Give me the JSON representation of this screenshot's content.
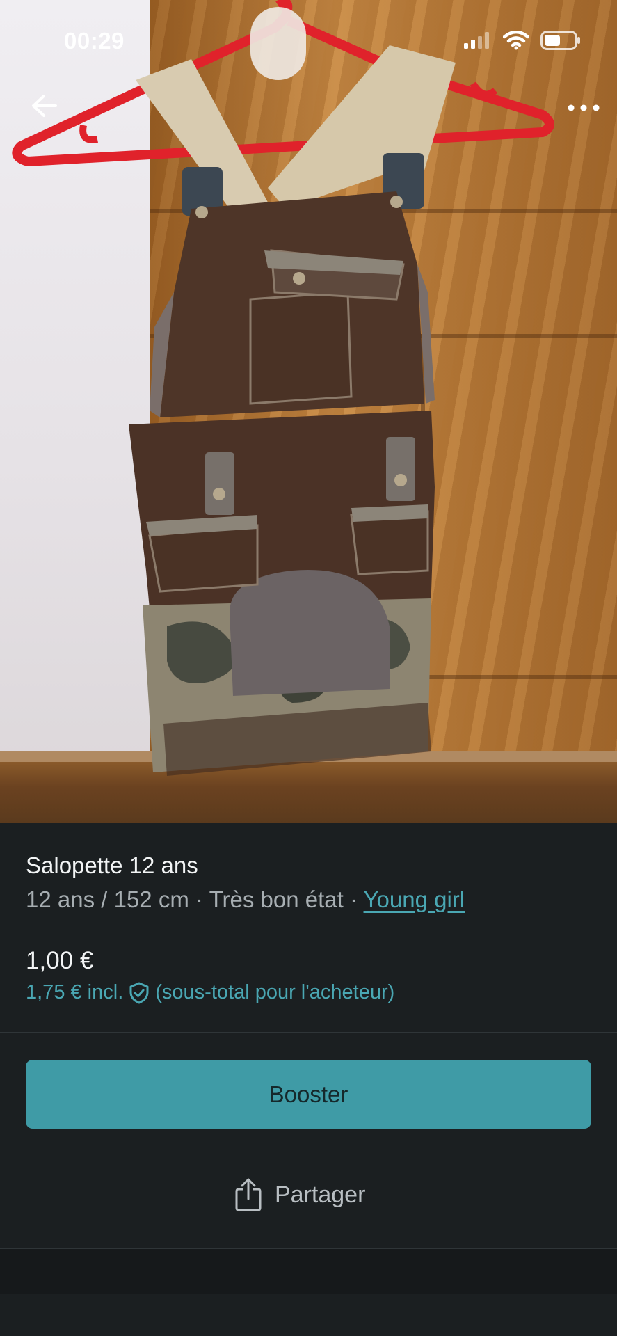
{
  "status_bar": {
    "time": "00:29"
  },
  "photo": {
    "back_icon": "arrow-left-icon",
    "more_icon": "more-horizontal-icon"
  },
  "item": {
    "title": "Salopette 12 ans",
    "size": "12 ans / 152 cm",
    "separator": "·",
    "condition": "Très bon état",
    "brand": "Young girl",
    "price": "1,00 €",
    "price_incl": "1,75 € incl.",
    "price_incl_note": "(sous-total pour l'acheteur)",
    "protection_icon": "shield-check-icon"
  },
  "actions": {
    "booster_label": "Booster",
    "share_label": "Partager",
    "share_icon": "share-icon"
  },
  "colors": {
    "accent": "#3f9ba6",
    "link": "#4aa7b3",
    "background": "#1b1f21"
  }
}
